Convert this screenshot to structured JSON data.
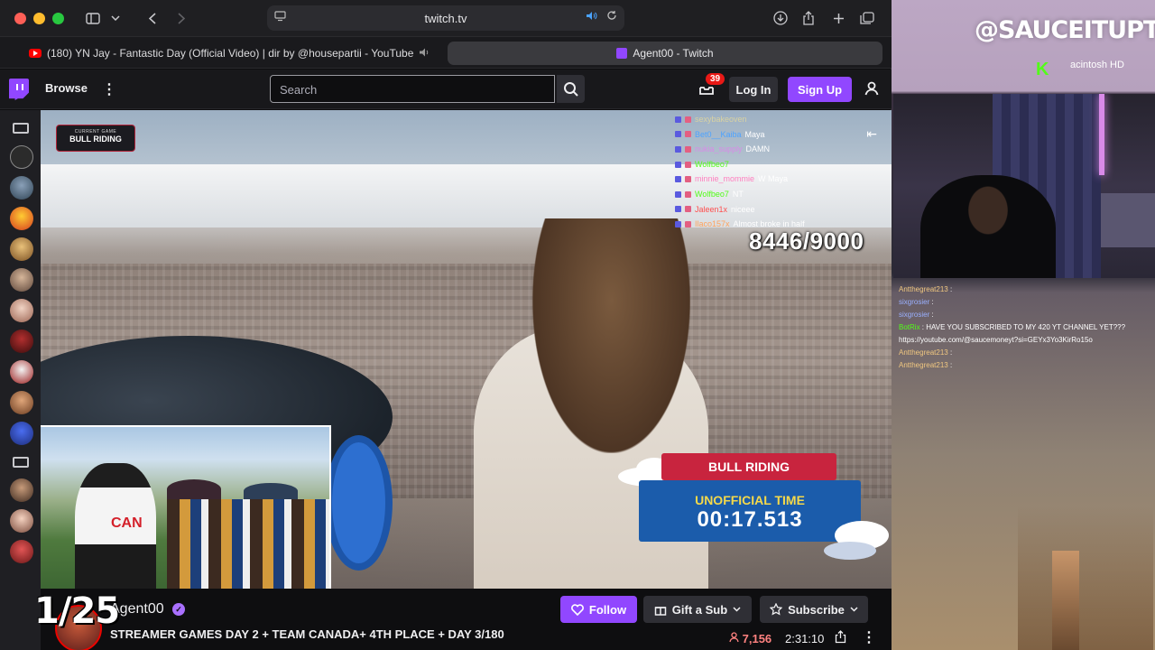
{
  "browser": {
    "url": "twitch.tv",
    "tabs": [
      {
        "label": "(180) YN Jay - Fantastic Day (Official Video) | dir by @housepartii - YouTube",
        "active": false
      },
      {
        "label": "Agent00 - Twitch",
        "active": true
      }
    ]
  },
  "twitch_nav": {
    "browse": "Browse",
    "search_placeholder": "Search",
    "notifications_count": "39",
    "login": "Log In",
    "signup": "Sign Up"
  },
  "player": {
    "current_game_label": "CURRENT GAME",
    "current_game": "BULL RIDING",
    "chat_overlay": [
      {
        "user": "sexybakeoven",
        "msg": ""
      },
      {
        "user": "Bet0__Kaiba",
        "msg": "Maya"
      },
      {
        "user": "nukia_supply",
        "msg": "DAMN"
      },
      {
        "user": "Wolfbeo7",
        "msg": ""
      },
      {
        "user": "minnie_mommie",
        "msg": "W Maya"
      },
      {
        "user": "Wolfbeo7",
        "msg": "NT"
      },
      {
        "user": "Jaleen1x",
        "msg": "niceee"
      },
      {
        "user": "Ilaco157x",
        "msg": "Almost broke in half"
      }
    ],
    "progress_counter": "8446/9000",
    "event_banner": "BULL RIDING",
    "unofficial_time_label": "UNOFFICIAL TIME",
    "unofficial_time": "00:17.513",
    "pip_jersey_text": "CAN"
  },
  "channel": {
    "name": "Agent00",
    "title": "STREAMER GAMES DAY 2 + TEAM CANADA+ 4TH PLACE + DAY 3/180",
    "follow": "Follow",
    "gift": "Gift a Sub",
    "subscribe": "Subscribe",
    "viewers": "7,156",
    "uptime": "2:31:10"
  },
  "overlay_counter": "1/25",
  "right_panel": {
    "handle": "@SAUCEITUPTV",
    "drive_label": "acintosh HD",
    "chat": [
      {
        "user": "Antthegreat213",
        "msg": ""
      },
      {
        "user": "sixgrosier",
        "msg": ""
      },
      {
        "user": "sixgrosier",
        "msg": ""
      },
      {
        "user": "BotRix",
        "msg": "HAVE YOU SUBSCRIBED TO MY 420 YT CHANNEL YET???"
      },
      {
        "user": "",
        "msg": "https://youtube.com/@saucemoneyt?si=GEYx3Yo3KirRo15o"
      },
      {
        "user": "Antthegreat213",
        "msg": ""
      },
      {
        "user": "Antthegreat213",
        "msg": ""
      }
    ]
  },
  "colors": {
    "twitch_purple": "#9147ff",
    "live_red": "#eb0400",
    "viewer_red": "#ff8280"
  }
}
